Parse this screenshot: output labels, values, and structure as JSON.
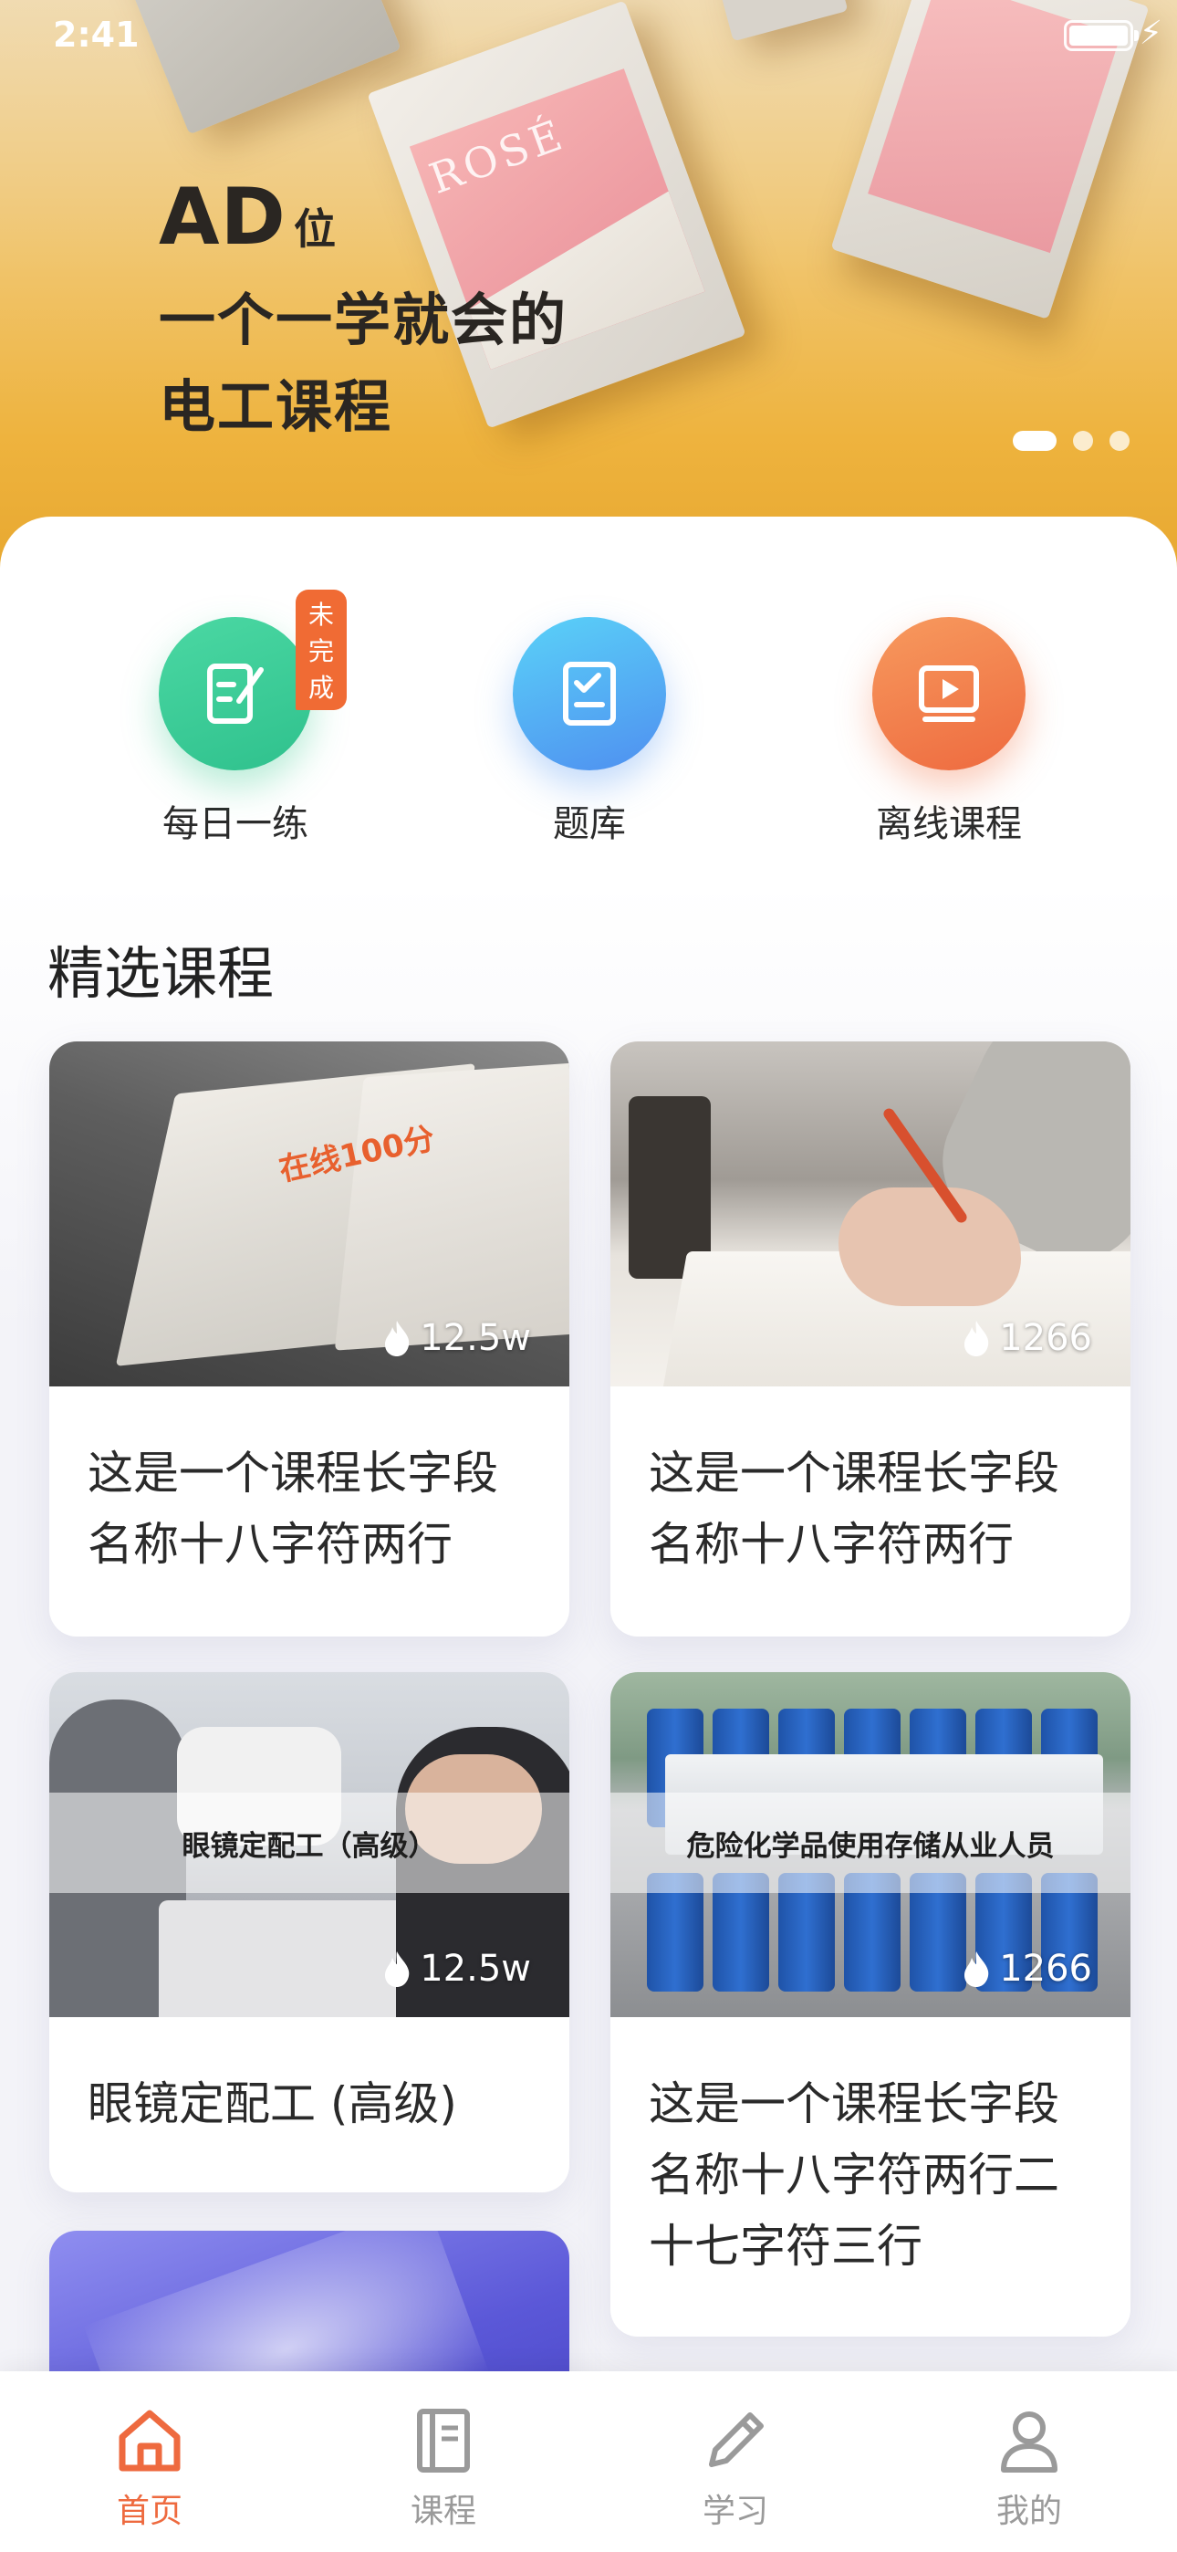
{
  "status_bar": {
    "time": "2:41"
  },
  "banner": {
    "ad_big": "AD",
    "ad_small": "位",
    "line1": "一个一学就会的",
    "line2": "电工课程",
    "book_brand": "ROSÉ",
    "page_count": 3,
    "active_page": 1
  },
  "quick_actions": [
    {
      "label": "每日一练",
      "icon": "edit-note-icon",
      "badge": "未完成",
      "color": "#34c98f"
    },
    {
      "label": "题库",
      "icon": "checklist-icon",
      "color": "#4f9bf2"
    },
    {
      "label": "离线课程",
      "icon": "video-play-icon",
      "color": "#ef7043"
    }
  ],
  "section_title": "精选课程",
  "courses": [
    {
      "views": "12.5w",
      "title": "这是一个课程长字段名称十八字符两行",
      "cover_text": "在线100分"
    },
    {
      "views": "1266",
      "title": "这是一个课程长字段名称十八字符两行"
    },
    {
      "views": "12.5w",
      "title": "眼镜定配工 (高级)",
      "overlay": "眼镜定配工（高级）"
    },
    {
      "views": "1266",
      "title": "这是一个课程长字段名称十八字符两行二十七字符三行",
      "overlay": "危险化学品使用存储从业人员"
    }
  ],
  "tabbar": [
    {
      "label": "首页",
      "icon": "home-icon",
      "active": true
    },
    {
      "label": "课程",
      "icon": "book-icon",
      "active": false
    },
    {
      "label": "学习",
      "icon": "pencil-icon",
      "active": false
    },
    {
      "label": "我的",
      "icon": "user-icon",
      "active": false
    }
  ],
  "colors": {
    "accent": "#ee6a3f",
    "inactive": "#9a9a9a"
  }
}
